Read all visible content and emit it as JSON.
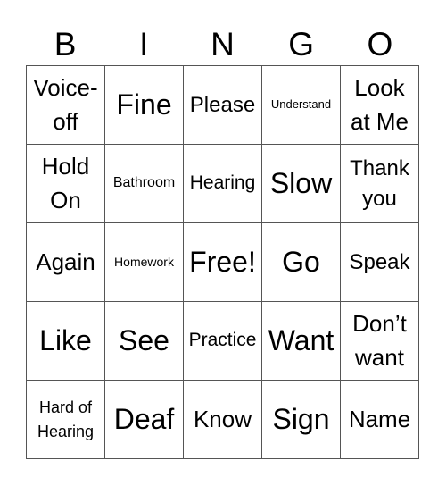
{
  "header": {
    "letters": [
      "B",
      "I",
      "N",
      "G",
      "O"
    ]
  },
  "board": {
    "rows": [
      [
        {
          "text": "Voice-off",
          "size": "s26"
        },
        {
          "text": "Fine",
          "size": "s31"
        },
        {
          "text": "Please",
          "size": "s24"
        },
        {
          "text": "Understand",
          "size": "s13"
        },
        {
          "text": "Look at Me",
          "size": "s26"
        }
      ],
      [
        {
          "text": "Hold On",
          "size": "s26"
        },
        {
          "text": "Bathroom",
          "size": "s16"
        },
        {
          "text": "Hearing",
          "size": "s21"
        },
        {
          "text": "Slow",
          "size": "s31"
        },
        {
          "text": "Thank you",
          "size": "s24"
        }
      ],
      [
        {
          "text": "Again",
          "size": "s26"
        },
        {
          "text": "Homework",
          "size": "s14"
        },
        {
          "text": "Free!",
          "size": "s31"
        },
        {
          "text": "Go",
          "size": "s31"
        },
        {
          "text": "Speak",
          "size": "s24"
        }
      ],
      [
        {
          "text": "Like",
          "size": "s31"
        },
        {
          "text": "See",
          "size": "s31"
        },
        {
          "text": "Practice",
          "size": "s21"
        },
        {
          "text": "Want",
          "size": "s31"
        },
        {
          "text": "Don’t want",
          "size": "s26"
        }
      ],
      [
        {
          "text": "Hard of Hearing",
          "size": "s19"
        },
        {
          "text": "Deaf",
          "size": "s31"
        },
        {
          "text": "Know",
          "size": "s26"
        },
        {
          "text": "Sign",
          "size": "s31"
        },
        {
          "text": "Name",
          "size": "s26"
        }
      ]
    ]
  }
}
